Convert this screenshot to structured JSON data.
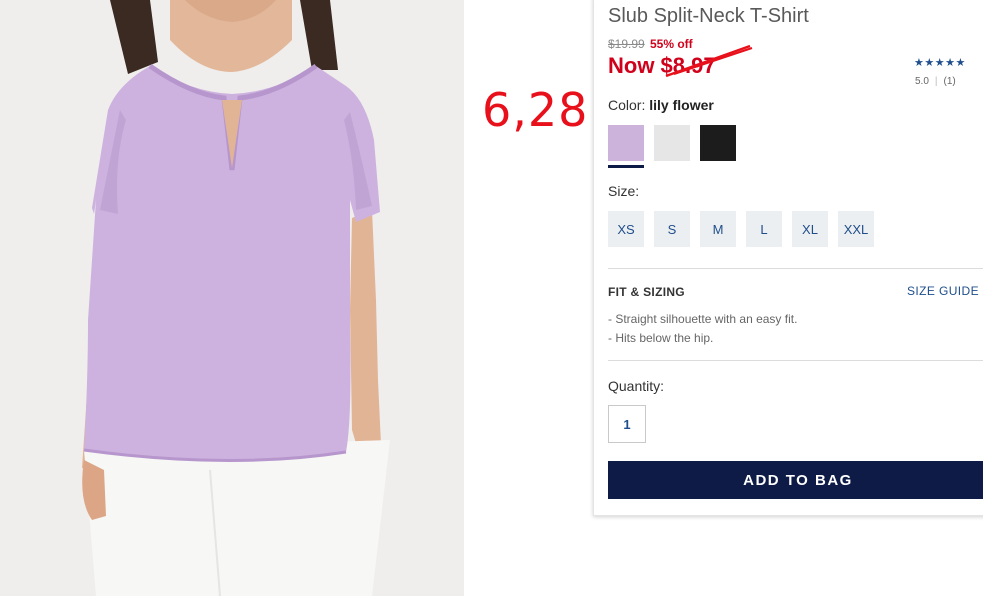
{
  "product": {
    "title": "Slub Split-Neck T-Shirt",
    "original_price": "$19.99",
    "discount": "55% off",
    "now_price": "Now $8.97",
    "rating": {
      "stars": "★★★★★",
      "score": "5.0",
      "count": "(1)"
    }
  },
  "annotation": {
    "handwritten_price": "6,28"
  },
  "color": {
    "label": "Color:",
    "selected": "lily flower",
    "swatches": [
      {
        "name": "lily flower",
        "hex": "#cbb3dc"
      },
      {
        "name": "white",
        "hex": "#e6e6e6"
      },
      {
        "name": "black",
        "hex": "#1c1c1c"
      }
    ]
  },
  "size": {
    "label": "Size:",
    "options": [
      "XS",
      "S",
      "M",
      "L",
      "XL",
      "XXL"
    ]
  },
  "fit": {
    "title": "FIT & SIZING",
    "size_guide": "SIZE GUIDE",
    "items": [
      "- Straight silhouette with an easy fit.",
      "- Hits below the hip."
    ]
  },
  "quantity": {
    "label": "Quantity:",
    "value": "1"
  },
  "cart": {
    "add_label": "ADD TO BAG"
  },
  "colors": {
    "accent": "#0d1b46",
    "sale": "#d0021b",
    "link": "#1f4e8c",
    "annotation": "#e8101a"
  }
}
